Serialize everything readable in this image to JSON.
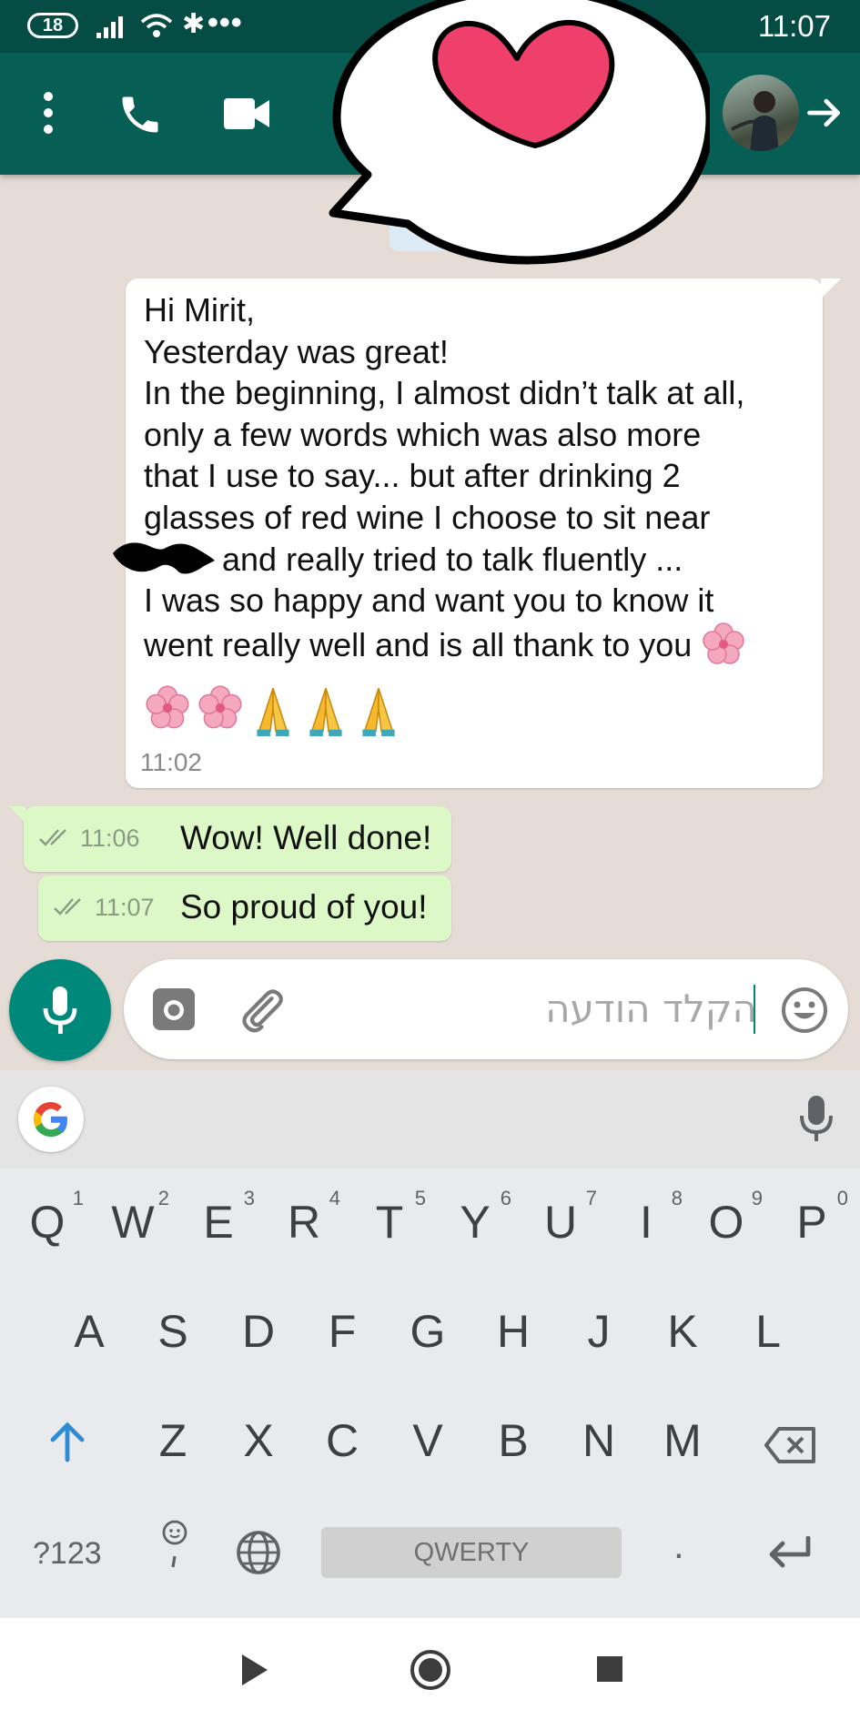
{
  "status_bar": {
    "battery": "18",
    "time": "11:07",
    "icons": [
      "signal-icon",
      "wifi-icon",
      "bluetooth-icon",
      "more-dots-icon"
    ]
  },
  "app_bar": {
    "icons": [
      "overflow-menu-icon",
      "voice-call-icon",
      "video-call-icon",
      "contact-avatar",
      "forward-arrow-icon"
    ],
    "color": "#075e54"
  },
  "sticker": {
    "icon": "heart-speech-bubble-icon",
    "heart_color": "#ef3f6b"
  },
  "messages": {
    "incoming": {
      "line1": "Hi Mirit,",
      "line2": "Yesterday was great!",
      "line3": "In the beginning, I almost didn’t talk at all,",
      "line4": "only a few words which was also more",
      "line5": "that I use to say... but after drinking 2",
      "line6": "glasses of red wine I choose to sit near",
      "line7": "and really tried to talk fluently ...",
      "line8": "I was so happy and want you to know it",
      "line9": "went really well and is all thank to you",
      "emojis": [
        "cherry-blossom-icon",
        "cherry-blossom-icon",
        "folded-hands-icon",
        "folded-hands-icon",
        "folded-hands-icon"
      ],
      "time": "11:02"
    },
    "outgoing": [
      {
        "text": "Wow! Well done!",
        "time": "11:06"
      },
      {
        "text": "So proud of you!",
        "time": "11:07"
      }
    ]
  },
  "composer": {
    "placeholder": "הקלד הודעה",
    "icons": [
      "mic-icon",
      "camera-icon",
      "attach-icon",
      "emoji-icon"
    ],
    "accent": "#00897b"
  },
  "keyboard": {
    "row1": [
      {
        "k": "Q",
        "n": "1"
      },
      {
        "k": "W",
        "n": "2"
      },
      {
        "k": "E",
        "n": "3"
      },
      {
        "k": "R",
        "n": "4"
      },
      {
        "k": "T",
        "n": "5"
      },
      {
        "k": "Y",
        "n": "6"
      },
      {
        "k": "U",
        "n": "7"
      },
      {
        "k": "I",
        "n": "8"
      },
      {
        "k": "O",
        "n": "9"
      },
      {
        "k": "P",
        "n": "0"
      }
    ],
    "row2": [
      "A",
      "S",
      "D",
      "F",
      "G",
      "H",
      "J",
      "K",
      "L"
    ],
    "row3": [
      "Z",
      "X",
      "C",
      "V",
      "B",
      "N",
      "M"
    ],
    "symbols_label": "?123",
    "space_label": "QWERTY",
    "period": ".",
    "icons": [
      "google-icon",
      "keyboard-mic-icon",
      "shift-icon",
      "backspace-icon",
      "emoji-comma-icon",
      "globe-icon",
      "enter-icon"
    ]
  },
  "nav_bar": {
    "icons": [
      "back-icon",
      "home-icon",
      "recents-icon"
    ]
  }
}
